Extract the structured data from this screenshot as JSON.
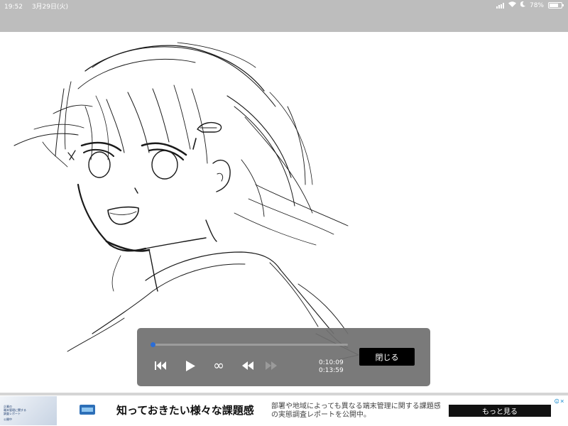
{
  "status_bar": {
    "time": "19:52",
    "date": "3月29日(火)",
    "battery": "78%",
    "battery_level": 0.78
  },
  "player": {
    "progress": 0.0,
    "current_time": "0:10:09",
    "total_time": "0:13:59",
    "close_label": "閉じる",
    "loop_symbol": "∞"
  },
  "ad": {
    "headline": "知っておきたい様々な課題感",
    "body": "部署や地域によっても異なる端末管理に関する課題感の実態調査レポートを公開中。",
    "cta": "もっと見る",
    "thumb_lines": [
      "企業の",
      "端末管理に関する",
      "調査レポート",
      "公開中"
    ]
  },
  "colors": {
    "status_bar_bg": "#bdbdbd",
    "player_bg": "#707070",
    "progress_dot": "#2b6dd6",
    "close_button_bg": "#000000"
  },
  "icons": [
    "signal-icon",
    "wifi-icon",
    "moon-icon",
    "battery-icon",
    "skip-to-start-icon",
    "play-icon",
    "loop-icon",
    "rewind-icon",
    "fast-forward-icon",
    "ad-choices-icon"
  ]
}
